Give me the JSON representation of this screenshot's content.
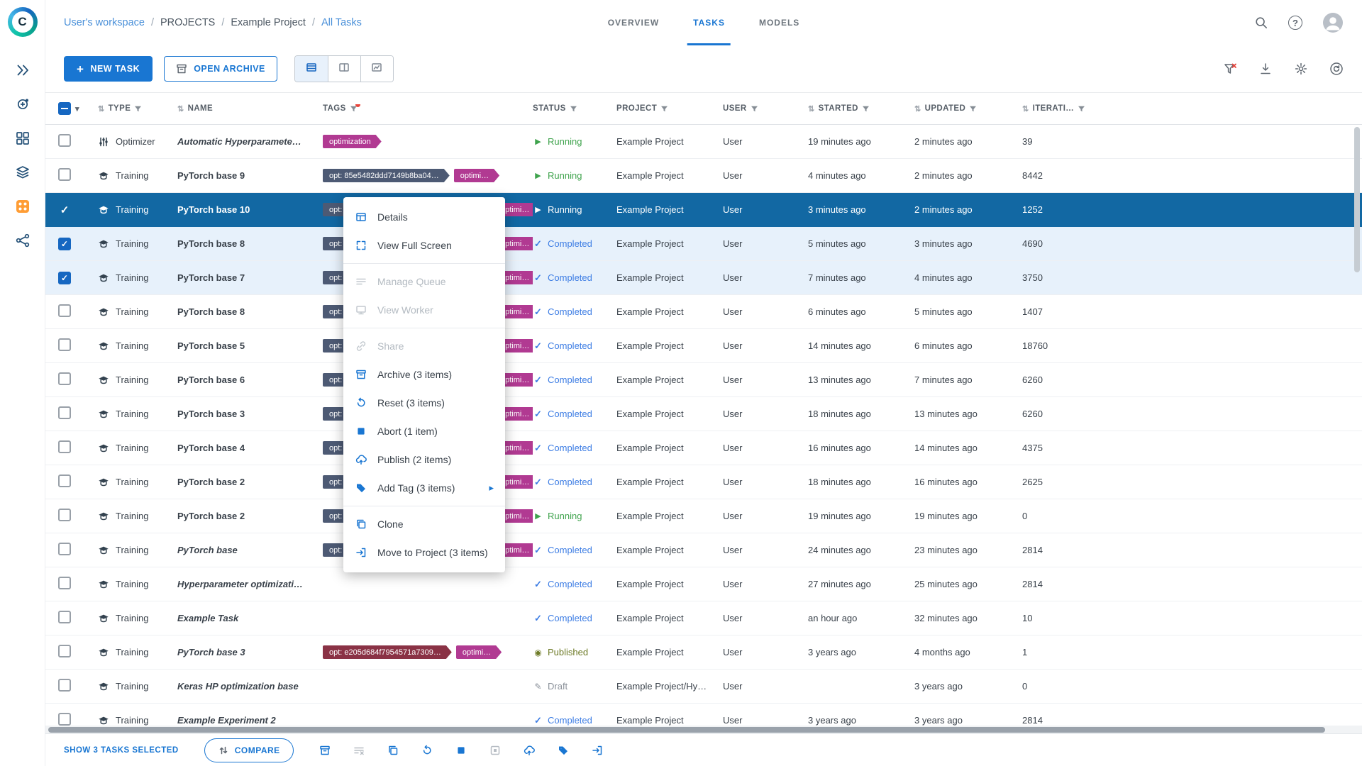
{
  "colors": {
    "primary": "#1976d2",
    "selected_row": "#1268a3",
    "running": "#3fa34d",
    "completed": "#3d7de4",
    "published": "#6e7b27",
    "draft": "#8a9099",
    "tag_magenta": "#b13a92",
    "tag_dark": "#4d5a74",
    "tag_maroon": "#8a3245"
  },
  "sidebar": {
    "items": [
      "launch",
      "deploy",
      "dashboard",
      "datasets",
      "current-project",
      "pipelines"
    ],
    "active_index": 4
  },
  "topbar": {
    "breadcrumb": [
      {
        "label": "User's workspace",
        "link": true
      },
      {
        "label": "PROJECTS",
        "link": false
      },
      {
        "label": "Example Project",
        "link": false
      },
      {
        "label": "All Tasks",
        "link": true
      }
    ],
    "tabs": [
      {
        "label": "OVERVIEW",
        "active": false
      },
      {
        "label": "TASKS",
        "active": true
      },
      {
        "label": "MODELS",
        "active": false
      }
    ],
    "icons": [
      "search",
      "help",
      "avatar"
    ]
  },
  "toolbar": {
    "new_task_label": "NEW TASK",
    "open_archive_label": "OPEN ARCHIVE",
    "views": [
      "table-view",
      "split-view",
      "chart-view"
    ],
    "active_view": 0,
    "right_icons": [
      {
        "name": "clear-filters",
        "accent": true
      },
      {
        "name": "download"
      },
      {
        "name": "settings"
      },
      {
        "name": "auto-refresh"
      }
    ]
  },
  "table": {
    "headers": [
      {
        "label": "TYPE",
        "sort": true,
        "filter": true
      },
      {
        "label": "NAME",
        "sort": true,
        "filter": false
      },
      {
        "label": "TAGS",
        "sort": false,
        "filter": true,
        "filter_active": true
      },
      {
        "label": "STATUS",
        "sort": false,
        "filter": true
      },
      {
        "label": "PROJECT",
        "sort": false,
        "filter": true
      },
      {
        "label": "USER",
        "sort": false,
        "filter": true
      },
      {
        "label": "STARTED",
        "sort": true,
        "filter": true
      },
      {
        "label": "UPDATED",
        "sort": true,
        "filter": true
      },
      {
        "label": "ITERATI…",
        "sort": true,
        "filter": true
      }
    ],
    "rows": [
      {
        "checked": false,
        "selected": false,
        "type": "Optimizer",
        "type_icon": "optimizer",
        "name": "Automatic Hyperparamete…",
        "italic": true,
        "tags": [
          {
            "text": "optimization",
            "style": "magenta"
          }
        ],
        "status": "Running",
        "project": "Example Project",
        "user": "User",
        "started": "19 minutes ago",
        "updated": "2 minutes ago",
        "iterations": "39"
      },
      {
        "checked": false,
        "selected": false,
        "type": "Training",
        "type_icon": "training",
        "name": "PyTorch base 9",
        "italic": false,
        "tags": [
          {
            "text": "opt: 85e5482ddd7149b8ba04…",
            "style": "dark"
          },
          {
            "text": "optimi…",
            "style": "magenta"
          }
        ],
        "status": "Running",
        "project": "Example Project",
        "user": "User",
        "started": "4 minutes ago",
        "updated": "2 minutes ago",
        "iterations": "8442"
      },
      {
        "checked": true,
        "selected": true,
        "type": "Training",
        "type_icon": "training",
        "name": "PyTorch base 10",
        "italic": false,
        "tags": [
          {
            "text": "opt: …",
            "style": "dark",
            "clipped": true
          },
          {
            "text": "optimi…",
            "style": "magenta"
          }
        ],
        "status": "Running",
        "project": "Example Project",
        "user": "User",
        "started": "3 minutes ago",
        "updated": "2 minutes ago",
        "iterations": "1252"
      },
      {
        "checked": true,
        "selected": false,
        "type": "Training",
        "type_icon": "training",
        "name": "PyTorch base 8",
        "italic": false,
        "tags": [
          {
            "text": "opt: …",
            "style": "dark",
            "clipped": true
          },
          {
            "text": "optimi…",
            "style": "magenta"
          }
        ],
        "status": "Completed",
        "project": "Example Project",
        "user": "User",
        "started": "5 minutes ago",
        "updated": "3 minutes ago",
        "iterations": "4690"
      },
      {
        "checked": true,
        "selected": false,
        "type": "Training",
        "type_icon": "training",
        "name": "PyTorch base 7",
        "italic": false,
        "tags": [
          {
            "text": "opt: …",
            "style": "dark",
            "clipped": true
          },
          {
            "text": "optimi…",
            "style": "magenta"
          }
        ],
        "status": "Completed",
        "project": "Example Project",
        "user": "User",
        "started": "7 minutes ago",
        "updated": "4 minutes ago",
        "iterations": "3750"
      },
      {
        "checked": false,
        "selected": false,
        "type": "Training",
        "type_icon": "training",
        "name": "PyTorch base 8",
        "italic": false,
        "tags": [
          {
            "text": "opt: …",
            "style": "dark",
            "clipped": true
          },
          {
            "text": "optimi…",
            "style": "magenta"
          }
        ],
        "status": "Completed",
        "project": "Example Project",
        "user": "User",
        "started": "6 minutes ago",
        "updated": "5 minutes ago",
        "iterations": "1407"
      },
      {
        "checked": false,
        "selected": false,
        "type": "Training",
        "type_icon": "training",
        "name": "PyTorch base 5",
        "italic": false,
        "tags": [
          {
            "text": "opt: …",
            "style": "dark",
            "clipped": true
          },
          {
            "text": "optimi…",
            "style": "magenta"
          }
        ],
        "status": "Completed",
        "project": "Example Project",
        "user": "User",
        "started": "14 minutes ago",
        "updated": "6 minutes ago",
        "iterations": "18760"
      },
      {
        "checked": false,
        "selected": false,
        "type": "Training",
        "type_icon": "training",
        "name": "PyTorch base 6",
        "italic": false,
        "tags": [
          {
            "text": "opt: …",
            "style": "dark",
            "clipped": true
          },
          {
            "text": "optimi…",
            "style": "magenta"
          }
        ],
        "status": "Completed",
        "project": "Example Project",
        "user": "User",
        "started": "13 minutes ago",
        "updated": "7 minutes ago",
        "iterations": "6260"
      },
      {
        "checked": false,
        "selected": false,
        "type": "Training",
        "type_icon": "training",
        "name": "PyTorch base 3",
        "italic": false,
        "tags": [
          {
            "text": "opt: …",
            "style": "dark",
            "clipped": true
          },
          {
            "text": "optimi…",
            "style": "magenta"
          }
        ],
        "status": "Completed",
        "project": "Example Project",
        "user": "User",
        "started": "18 minutes ago",
        "updated": "13 minutes ago",
        "iterations": "6260"
      },
      {
        "checked": false,
        "selected": false,
        "type": "Training",
        "type_icon": "training",
        "name": "PyTorch base 4",
        "italic": false,
        "tags": [
          {
            "text": "opt: …",
            "style": "dark",
            "clipped": true
          },
          {
            "text": "optimi…",
            "style": "magenta"
          }
        ],
        "status": "Completed",
        "project": "Example Project",
        "user": "User",
        "started": "16 minutes ago",
        "updated": "14 minutes ago",
        "iterations": "4375"
      },
      {
        "checked": false,
        "selected": false,
        "type": "Training",
        "type_icon": "training",
        "name": "PyTorch base 2",
        "italic": false,
        "tags": [
          {
            "text": "opt: …",
            "style": "dark",
            "clipped": true
          },
          {
            "text": "optimi…",
            "style": "magenta"
          }
        ],
        "status": "Completed",
        "project": "Example Project",
        "user": "User",
        "started": "18 minutes ago",
        "updated": "16 minutes ago",
        "iterations": "2625"
      },
      {
        "checked": false,
        "selected": false,
        "type": "Training",
        "type_icon": "training",
        "name": "PyTorch base 2",
        "italic": false,
        "tags": [
          {
            "text": "opt: …",
            "style": "dark",
            "clipped": true
          },
          {
            "text": "optimi…",
            "style": "magenta"
          }
        ],
        "status": "Running",
        "project": "Example Project",
        "user": "User",
        "started": "19 minutes ago",
        "updated": "19 minutes ago",
        "iterations": "0"
      },
      {
        "checked": false,
        "selected": false,
        "type": "Training",
        "type_icon": "training",
        "name": "PyTorch base",
        "italic": true,
        "tags": [
          {
            "text": "opt: …",
            "style": "dark",
            "clipped": true
          },
          {
            "text": "optimi…",
            "style": "magenta"
          }
        ],
        "status": "Completed",
        "project": "Example Project",
        "user": "User",
        "started": "24 minutes ago",
        "updated": "23 minutes ago",
        "iterations": "2814"
      },
      {
        "checked": false,
        "selected": false,
        "type": "Training",
        "type_icon": "training",
        "name": "Hyperparameter optimizati…",
        "italic": true,
        "tags": [],
        "status": "Completed",
        "project": "Example Project",
        "user": "User",
        "started": "27 minutes ago",
        "updated": "25 minutes ago",
        "iterations": "2814"
      },
      {
        "checked": false,
        "selected": false,
        "type": "Training",
        "type_icon": "training",
        "name": "Example Task",
        "italic": true,
        "tags": [],
        "status": "Completed",
        "project": "Example Project",
        "user": "User",
        "started": "an hour ago",
        "updated": "32 minutes ago",
        "iterations": "10"
      },
      {
        "checked": false,
        "selected": false,
        "type": "Training",
        "type_icon": "training",
        "name": "PyTorch base 3",
        "italic": true,
        "tags": [
          {
            "text": "opt: e205d684f7954571a7309…",
            "style": "maroon"
          },
          {
            "text": "optimi…",
            "style": "magenta"
          }
        ],
        "status": "Published",
        "project": "Example Project",
        "user": "User",
        "started": "3 years ago",
        "updated": "4 months ago",
        "iterations": "1"
      },
      {
        "checked": false,
        "selected": false,
        "type": "Training",
        "type_icon": "training",
        "name": "Keras HP optimization base",
        "italic": true,
        "tags": [],
        "status": "Draft",
        "project": "Example Project/Hy…",
        "user": "User",
        "started": "",
        "updated": "3 years ago",
        "iterations": "0"
      },
      {
        "checked": false,
        "selected": false,
        "type": "Training",
        "type_icon": "training",
        "name": "Example Experiment 2",
        "italic": true,
        "tags": [],
        "status": "Completed",
        "project": "Example Project",
        "user": "User",
        "started": "3 years ago",
        "updated": "3 years ago",
        "iterations": "2814"
      }
    ]
  },
  "context_menu": {
    "items": [
      {
        "label": "Details",
        "icon": "details"
      },
      {
        "label": "View Full Screen",
        "icon": "fullscreen"
      },
      {
        "divider": true
      },
      {
        "label": "Manage Queue",
        "icon": "queue",
        "disabled": true
      },
      {
        "label": "View Worker",
        "icon": "worker",
        "disabled": true
      },
      {
        "divider": true
      },
      {
        "label": "Share",
        "icon": "share",
        "disabled": true
      },
      {
        "label": "Archive (3 items)",
        "icon": "archive"
      },
      {
        "label": "Reset (3 items)",
        "icon": "reset"
      },
      {
        "label": "Abort (1 item)",
        "icon": "abort"
      },
      {
        "label": "Publish (2 items)",
        "icon": "publish"
      },
      {
        "label": "Add Tag (3 items)",
        "icon": "tag",
        "submenu": true
      },
      {
        "divider": true
      },
      {
        "label": "Clone",
        "icon": "clone"
      },
      {
        "label": "Move to Project (3 items)",
        "icon": "move"
      }
    ]
  },
  "footer": {
    "selected_label": "SHOW 3 TASKS SELECTED",
    "compare_label": "COMPARE",
    "actions": [
      {
        "name": "archive",
        "disabled": false
      },
      {
        "name": "dequeue",
        "disabled": true
      },
      {
        "name": "clone",
        "disabled": false
      },
      {
        "name": "reset",
        "disabled": false
      },
      {
        "name": "abort",
        "disabled": false
      },
      {
        "name": "abort-children",
        "disabled": true
      },
      {
        "name": "publish",
        "disabled": false
      },
      {
        "name": "tag",
        "disabled": false
      },
      {
        "name": "move",
        "disabled": false
      }
    ]
  }
}
